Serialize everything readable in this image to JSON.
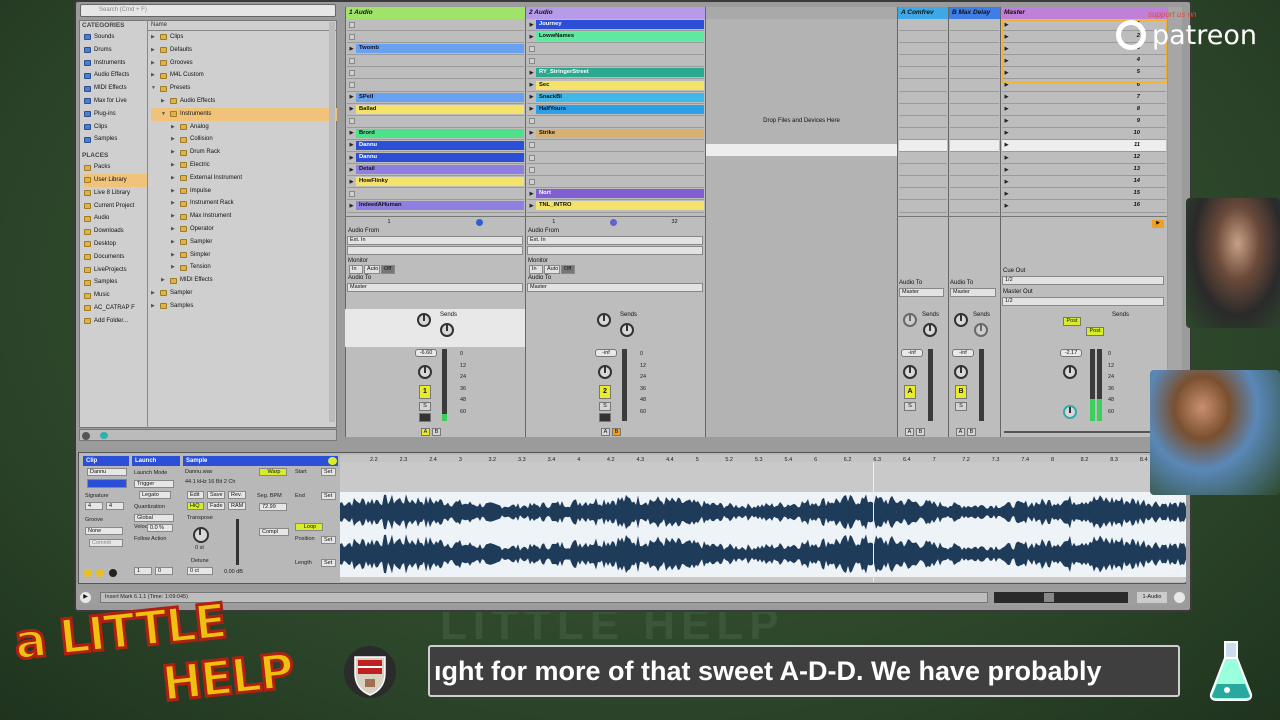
{
  "search": {
    "placeholder": "Search (Cmd + F)"
  },
  "browser": {
    "categories_header": "CATEGORIES",
    "categories": [
      "Sounds",
      "Drums",
      "Instruments",
      "Audio Effects",
      "MIDI Effects",
      "Max for Live",
      "Plug-ins",
      "Clips",
      "Samples"
    ],
    "places_header": "PLACES",
    "places": [
      "Packs",
      "User Library",
      "Live 8 Library",
      "Current Project",
      "Audio",
      "Downloads",
      "Desktop",
      "Documents",
      "LiveProjects",
      "Samples",
      "Music",
      "AC_CATRAP F",
      "Add Folder..."
    ],
    "name_header": "Name",
    "tree": [
      "Clips",
      "Defaults",
      "Grooves",
      "M4L Custom",
      "Presets",
      "Audio Effects",
      "Instruments",
      "Analog",
      "Collision",
      "Drum Rack",
      "Electric",
      "External Instrument",
      "Impulse",
      "Instrument Rack",
      "Max Instrument",
      "Operator",
      "Sampler",
      "Simpler",
      "Tension",
      "MIDI Effects",
      "Sampler",
      "Samples"
    ]
  },
  "tracks": {
    "t1": {
      "name": "1 Audio"
    },
    "t2": {
      "name": "2 Audio"
    },
    "rA": {
      "name": "A Comfrev"
    },
    "rB": {
      "name": "B Max Delay"
    },
    "master": {
      "name": "Master"
    }
  },
  "clips_t1": [
    "",
    "",
    "Twomb",
    "",
    "",
    "",
    "SPell",
    "Ballad",
    "",
    "Brord",
    "Dannu",
    "Dannu",
    "Detail",
    "HowFlinky",
    "",
    "IndeedAHuman"
  ],
  "clips_t2": [
    "Journey",
    "LowwNames",
    "",
    "",
    "RY_StringerStreet",
    "Sec",
    "SnackBl",
    "HalfYours",
    "",
    "Strike",
    "",
    "",
    "",
    "",
    "Nort",
    "TNL_INTRO"
  ],
  "scenes": [
    "1",
    "2",
    "3",
    "4",
    "5",
    "6",
    "7",
    "8",
    "9",
    "10",
    "11",
    "12",
    "13",
    "14",
    "15",
    "16"
  ],
  "drop_text": "Drop Files and Devices Here",
  "io": {
    "audio_from": "Audio From",
    "ext_in": "Ext. In",
    "monitor": "Monitor",
    "mon_in": "In",
    "mon_auto": "Auto",
    "mon_off": "Off",
    "audio_to": "Audio To",
    "master": "Master",
    "cue_out": "Cue Out",
    "cue_val": "1/2",
    "master_out": "Master Out",
    "master_val": "1/2",
    "sends": "Sends",
    "post": "Post"
  },
  "mixer": {
    "t1_vol": "-6.60",
    "t2_vol": "-inf",
    "rA_vol": "-inf",
    "rB_vol": "-inf",
    "master_vol": "-2.17",
    "t1_num": "1",
    "t2_num": "2",
    "rA_letter": "A",
    "rB_letter": "B",
    "scale": [
      "0",
      "12",
      "24",
      "36",
      "48",
      "60"
    ],
    "solo": "S",
    "a": "A",
    "b": "B",
    "t1_pos": "1",
    "t2_pos": "1",
    "t2_len": "32"
  },
  "clip": {
    "tab_clip": "Clip",
    "tab_launch": "Launch",
    "tab_sample": "Sample",
    "name": "Dannu",
    "signature_label": "Signature",
    "sig_num": "4",
    "sig_den": "4",
    "groove_label": "Groove",
    "groove_val": "None",
    "commit": "Commit",
    "launch_mode_label": "Launch Mode",
    "launch_mode": "Trigger",
    "legato": "Legato",
    "quant_label": "Quantization",
    "quant_val": "Global",
    "vel_label": "Velocity",
    "vel_val": "0.0 %",
    "follow_label": "Follow Action",
    "follow_a": "1",
    "follow_b": "0",
    "file": "Dannu.wav",
    "format": "44.1 kHz 16 Bit 2 Ch",
    "edit": "Edit",
    "save": "Save",
    "rev": "Rev.",
    "hiq": "HiQ",
    "fade": "Fade",
    "ram": "RAM",
    "transpose_label": "Transpose",
    "transpose_val": "0 st",
    "detune_label": "Detune",
    "detune_val": "0 ct",
    "gain_val": "0.00 dB",
    "warp": "Warp",
    "seg_bpm_label": "Seg. BPM",
    "seg_bpm": "72.99",
    "complex": "Compl",
    "start_label": "Start",
    "end_label": "End",
    "loop": "Loop",
    "position_label": "Position",
    "length_label": "Length",
    "set": "Set",
    "page": "1/8",
    "ruler": [
      "2.2",
      "2.3",
      "2.4",
      "3",
      "3.2",
      "3.3",
      "3.4",
      "4",
      "4.2",
      "4.3",
      "4.4",
      "5",
      "5.2",
      "5.3",
      "5.4",
      "6",
      "6.2",
      "6.3",
      "6.4",
      "7",
      "7.2",
      "7.3",
      "7.4",
      "8",
      "8.2",
      "8.3",
      "8.4",
      "9"
    ]
  },
  "status": {
    "text": "Insert Mark 6.1.1 (Time: 1:09:045)",
    "track": "1-Audio"
  },
  "overlay": {
    "ticker": "ıght for more of that sweet A-D-D. We have probably",
    "logo_line1": "a LITTLE",
    "logo_line2": "HELP",
    "patreon_support": "support us on",
    "patreon": "patreon"
  }
}
